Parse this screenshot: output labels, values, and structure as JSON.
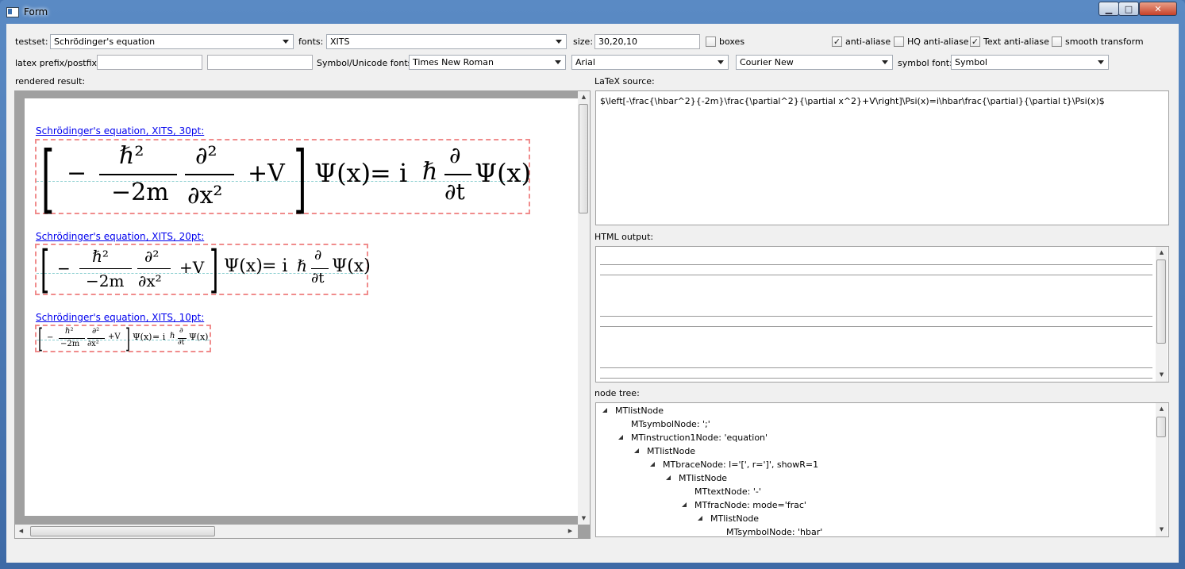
{
  "window": {
    "title": "Form"
  },
  "controls": {
    "testset_label": "testset:",
    "testset_value": "Schrödinger's equation",
    "fonts_label": "fonts:",
    "fonts_value": "XITS",
    "size_label": "size:",
    "size_value": "30,20,10",
    "boxes_label": "boxes",
    "antialias_label": "anti-aliase",
    "hq_antialias_label": "HQ anti-aliase",
    "text_antialias_label": "Text anti-aliase",
    "smooth_label": "smooth transform",
    "prefix_label": "latex prefix/postfix:",
    "symbol_fonts_label": "Symbol/Unicode fonts:",
    "font1": "Times New Roman",
    "font2": "Arial",
    "font3": "Courier New",
    "symbol_font_label": "symbol font:",
    "symbol_font_value": "Symbol"
  },
  "checks": {
    "boxes": false,
    "antialias": true,
    "hq": false,
    "text": true,
    "smooth": false,
    "checkmark": "✓"
  },
  "rendered": {
    "label": "rendered result:",
    "items": [
      {
        "title": "Schrödinger's equation, XITS, 30pt:"
      },
      {
        "title": "Schrödinger's equation, XITS, 20pt:"
      },
      {
        "title": "Schrödinger's equation, XITS, 10pt:"
      }
    ],
    "equation": {
      "minus": "−",
      "hbar2": "ℏ²",
      "neg2m": "−2m",
      "d2": "∂²",
      "dx2": "∂x²",
      "plusV": "+V",
      "psi_x": "Ψ(x)",
      "eq_i": "= i",
      "hbar": "ℏ",
      "partial": "∂",
      "dt": "∂t"
    }
  },
  "latex": {
    "label": "LaTeX source:",
    "source": "$\\left[-\\frac{\\hbar^2}{-2m}\\frac{\\partial^2}{\\partial x^2}+V\\right]\\Psi(x)=i\\hbar\\frac{\\partial}{\\partial t}\\Psi(x)$"
  },
  "html_output": {
    "label": "HTML output:"
  },
  "node_tree": {
    "label": "node tree:",
    "rows": [
      "MTlistNode",
      "MTsymbolNode: ';'",
      "MTinstruction1Node: 'equation'",
      "MTlistNode",
      "MTbraceNode: l='[', r=']', showR=1",
      "MTlistNode",
      "MTtextNode: '-'",
      "MTfracNode: mode='frac'",
      "MTlistNode",
      "MTsymbolNode: 'hbar'"
    ]
  },
  "icons": {
    "minimize": "minimize-icon",
    "maximize": "maximize-icon",
    "close": "close-icon"
  }
}
